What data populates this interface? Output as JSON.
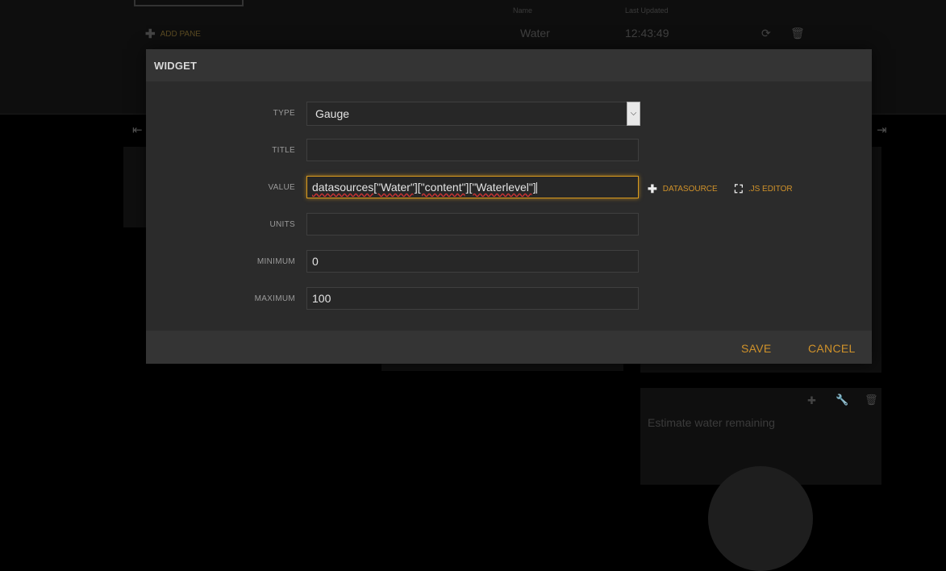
{
  "background": {
    "add_pane_label": "ADD PANE",
    "datasources_table": {
      "headers": [
        "Name",
        "Last Updated"
      ],
      "rows": [
        {
          "name": "Water",
          "last_updated": "12:43:49"
        }
      ]
    },
    "pane": {
      "title": "Estimate water remaining"
    },
    "icons": [
      "refresh-icon",
      "trash-icon",
      "plus-icon",
      "wrench-icon"
    ]
  },
  "modal": {
    "title": "WIDGET",
    "fields": {
      "type": {
        "label": "TYPE",
        "value": "Gauge"
      },
      "title": {
        "label": "TITLE",
        "value": ""
      },
      "value": {
        "label": "VALUE",
        "value": "datasources[\"Water\"][\"content\"][\"Waterlevel\"]"
      },
      "units": {
        "label": "UNITS",
        "value": ""
      },
      "minimum": {
        "label": "MINIMUM",
        "value": "0"
      },
      "maximum": {
        "label": "MAXIMUM",
        "value": "100"
      }
    },
    "actions": {
      "datasource": "DATASOURCE",
      "js_editor": ".JS EDITOR"
    },
    "footer": {
      "save": "SAVE",
      "cancel": "CANCEL"
    }
  },
  "colors": {
    "accent": "#d0922a",
    "focus_border": "#d99a1e",
    "modal_bg": "#2b2b2b",
    "modal_header_bg": "#343434"
  }
}
